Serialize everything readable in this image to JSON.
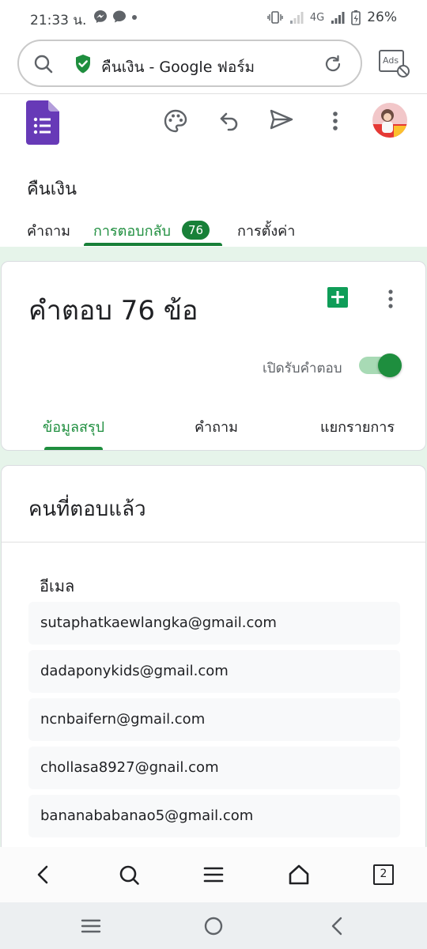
{
  "status_bar": {
    "time": "21:33 น.",
    "network": "4G",
    "battery": "26%"
  },
  "browser": {
    "url_text": "คืนเงิน - Google ฟอร์ม",
    "ads_label": "Ads"
  },
  "form": {
    "title": "คืนเงิน",
    "tabs": [
      {
        "label": "คำถาม"
      },
      {
        "label": "การตอบกลับ",
        "badge": "76"
      },
      {
        "label": "การตั้งค่า"
      }
    ]
  },
  "responses": {
    "heading": "คำตอบ 76 ข้อ",
    "accepting_label": "เปิดรับคำตอบ",
    "accepting": true,
    "subtabs": [
      {
        "label": "ข้อมูลสรุป"
      },
      {
        "label": "คำถาม"
      },
      {
        "label": "แยกรายการ"
      }
    ]
  },
  "respondents": {
    "heading": "คนที่ตอบแล้ว",
    "email_label": "อีเมล",
    "emails": [
      "sutaphatkaewlangka@gmail.com",
      "dadaponykids@gmail.com",
      "ncnbaifern@gmail.com",
      "chollasa8927@gnail.com",
      "bananababanao5@gmail.com"
    ]
  },
  "browser_nav": {
    "tab_count": "2"
  },
  "colors": {
    "accent_green": "#1e8e3e",
    "forms_purple": "#673ab7",
    "sheets_green": "#0f9d58",
    "page_bg": "#e6f4ea"
  }
}
